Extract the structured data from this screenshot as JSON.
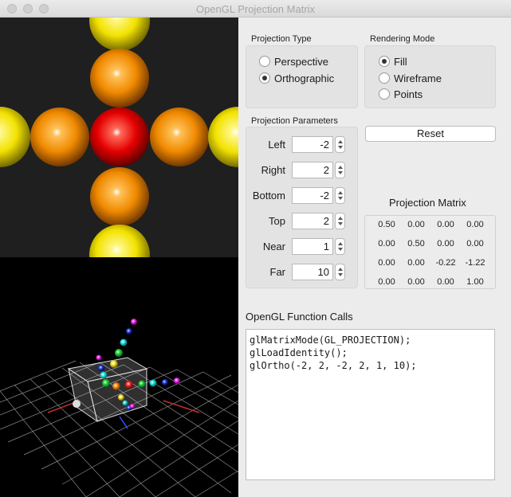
{
  "window": {
    "title": "OpenGL Projection Matrix"
  },
  "projection_type": {
    "title": "Projection Type",
    "options": [
      {
        "label": "Perspective",
        "selected": false
      },
      {
        "label": "Orthographic",
        "selected": true
      }
    ]
  },
  "rendering_mode": {
    "title": "Rendering Mode",
    "options": [
      {
        "label": "Fill",
        "selected": true
      },
      {
        "label": "Wireframe",
        "selected": false
      },
      {
        "label": "Points",
        "selected": false
      }
    ]
  },
  "parameters": {
    "title": "Projection Parameters",
    "items": [
      {
        "label": "Left",
        "value": "-2"
      },
      {
        "label": "Right",
        "value": "2"
      },
      {
        "label": "Bottom",
        "value": "-2"
      },
      {
        "label": "Top",
        "value": "2"
      },
      {
        "label": "Near",
        "value": "1"
      },
      {
        "label": "Far",
        "value": "10"
      }
    ]
  },
  "reset_label": "Reset",
  "matrix": {
    "title": "Projection Matrix",
    "rows": [
      [
        "0.50",
        "0.00",
        "0.00",
        "0.00"
      ],
      [
        "0.00",
        "0.50",
        "0.00",
        "0.00"
      ],
      [
        "0.00",
        "0.00",
        "-0.22",
        "-1.22"
      ],
      [
        "0.00",
        "0.00",
        "0.00",
        "1.00"
      ]
    ]
  },
  "function_calls": {
    "title": "OpenGL Function Calls",
    "lines": [
      "glMatrixMode(GL_PROJECTION);",
      "glLoadIdentity();",
      "glOrtho(-2, 2, -2, 2, 1, 10);"
    ]
  },
  "colors": {
    "sphere_red": "#e40000",
    "sphere_orange": "#f08a00",
    "sphere_yellow": "#f2e200",
    "top_view_bg": "#1f1f1f",
    "bottom_view_bg": "#000000"
  }
}
